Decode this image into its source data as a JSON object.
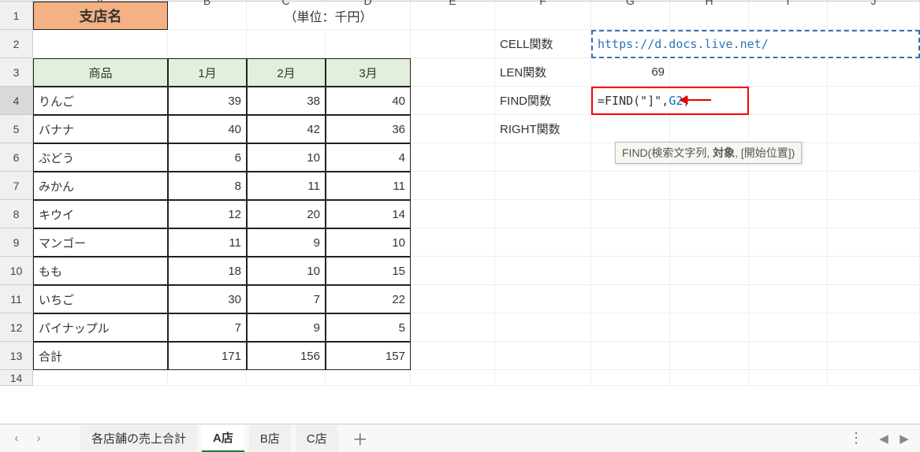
{
  "columns": [
    "A",
    "B",
    "C",
    "D",
    "E",
    "F",
    "G",
    "H",
    "I",
    "J"
  ],
  "rows": [
    "1",
    "2",
    "3",
    "4",
    "5",
    "6",
    "7",
    "8",
    "9",
    "10",
    "11",
    "12",
    "13",
    "14"
  ],
  "a1": "支店名",
  "unit": "（単位：千円）",
  "table": {
    "headers": {
      "product": "商品",
      "m1": "1月",
      "m2": "2月",
      "m3": "3月"
    },
    "rows": [
      {
        "name": "りんご",
        "m1": "39",
        "m2": "38",
        "m3": "40"
      },
      {
        "name": "バナナ",
        "m1": "40",
        "m2": "42",
        "m3": "36"
      },
      {
        "name": "ぶどう",
        "m1": "6",
        "m2": "10",
        "m3": "4"
      },
      {
        "name": "みかん",
        "m1": "8",
        "m2": "11",
        "m3": "11"
      },
      {
        "name": "キウイ",
        "m1": "12",
        "m2": "20",
        "m3": "14"
      },
      {
        "name": "マンゴー",
        "m1": "11",
        "m2": "9",
        "m3": "10"
      },
      {
        "name": "もも",
        "m1": "18",
        "m2": "10",
        "m3": "15"
      },
      {
        "name": "いちご",
        "m1": "30",
        "m2": "7",
        "m3": "22"
      },
      {
        "name": "パイナップル",
        "m1": "7",
        "m2": "9",
        "m3": "5"
      },
      {
        "name": "合計",
        "m1": "171",
        "m2": "156",
        "m3": "157"
      }
    ]
  },
  "labels": {
    "cell_fn": "CELL関数",
    "len_fn": "LEN関数",
    "find_fn": "FIND関数",
    "right_fn": "RIGHT関数"
  },
  "values": {
    "g2": "https://d.docs.live.net/",
    "g3": "69",
    "g4_prefix": "=FIND(\"]\",",
    "g4_ref": "G2",
    "g4_suffix": ")"
  },
  "tooltip": {
    "fn": "FIND(",
    "arg1": "検索文字列",
    "sep1": ", ",
    "arg2": "対象",
    "sep2": ", [",
    "arg3": "開始位置",
    "end": "])"
  },
  "tabs": {
    "summary": "各店舗の売上合計",
    "a": "A店",
    "b": "B店",
    "c": "C店",
    "add": "＋",
    "more": "⋮"
  },
  "nav": {
    "left": "‹",
    "right": "›",
    "scl": "◀",
    "scr": "▶"
  }
}
